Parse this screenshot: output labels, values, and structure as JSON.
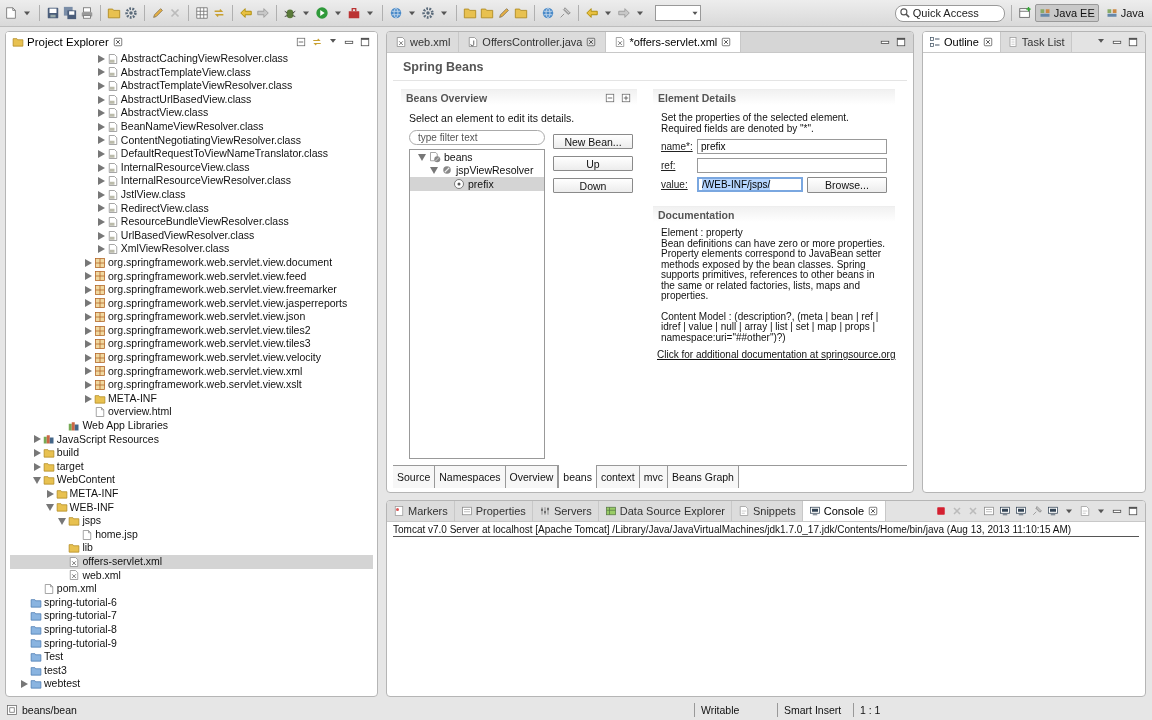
{
  "toolbar": {
    "quick_access": {
      "placeholder": "Quick Access"
    },
    "perspectives": [
      {
        "label": "Java EE",
        "selected": true
      },
      {
        "label": "Java",
        "selected": false
      }
    ]
  },
  "project_explorer": {
    "title": "Project Explorer",
    "tree": [
      {
        "children": [
          {
            "children": [
              {
                "children": [
                  {
                    "children": [
                      {
                        "children": [
                          {
                            "children": [
                              {
                                "label": "AbstractCachingViewResolver.class",
                                "kind": "class",
                                "expanded": false,
                                "selected": false
                              },
                              {
                                "label": "AbstractTemplateView.class",
                                "kind": "class",
                                "expanded": false,
                                "selected": false
                              },
                              {
                                "label": "AbstractTemplateViewResolver.class",
                                "kind": "class",
                                "expanded": false,
                                "selected": false
                              },
                              {
                                "label": "AbstractUrlBasedView.class",
                                "kind": "class",
                                "expanded": false,
                                "selected": false
                              },
                              {
                                "label": "AbstractView.class",
                                "kind": "class",
                                "expanded": false,
                                "selected": false
                              },
                              {
                                "label": "BeanNameViewResolver.class",
                                "kind": "class",
                                "expanded": false,
                                "selected": false
                              },
                              {
                                "label": "ContentNegotiatingViewResolver.class",
                                "kind": "class",
                                "expanded": false,
                                "selected": false
                              },
                              {
                                "label": "DefaultRequestToViewNameTranslator.class",
                                "kind": "class",
                                "expanded": false,
                                "selected": false
                              },
                              {
                                "label": "InternalResourceView.class",
                                "kind": "class",
                                "expanded": false,
                                "selected": false
                              },
                              {
                                "label": "InternalResourceViewResolver.class",
                                "kind": "class",
                                "expanded": false,
                                "selected": false
                              },
                              {
                                "label": "JstlView.class",
                                "kind": "class",
                                "expanded": false,
                                "selected": false
                              },
                              {
                                "label": "RedirectView.class",
                                "kind": "class",
                                "expanded": false,
                                "selected": false
                              },
                              {
                                "label": "ResourceBundleViewResolver.class",
                                "kind": "class",
                                "expanded": false,
                                "selected": false
                              },
                              {
                                "label": "UrlBasedViewResolver.class",
                                "kind": "class",
                                "expanded": false,
                                "selected": false
                              },
                              {
                                "label": "XmlViewResolver.class",
                                "kind": "class",
                                "expanded": false,
                                "selected": false
                              }
                            ]
                          },
                          {
                            "label": "org.springframework.web.servlet.view.document",
                            "kind": "package",
                            "expanded": false,
                            "selected": false
                          },
                          {
                            "label": "org.springframework.web.servlet.view.feed",
                            "kind": "package",
                            "expanded": false,
                            "selected": false
                          },
                          {
                            "label": "org.springframework.web.servlet.view.freemarker",
                            "kind": "package",
                            "expanded": false,
                            "selected": false
                          },
                          {
                            "label": "org.springframework.web.servlet.view.jasperreports",
                            "kind": "package",
                            "expanded": false,
                            "selected": false
                          },
                          {
                            "label": "org.springframework.web.servlet.view.json",
                            "kind": "package",
                            "expanded": false,
                            "selected": false
                          },
                          {
                            "label": "org.springframework.web.servlet.view.tiles2",
                            "kind": "package",
                            "expanded": false,
                            "selected": false
                          },
                          {
                            "label": "org.springframework.web.servlet.view.tiles3",
                            "kind": "package",
                            "expanded": false,
                            "selected": false
                          },
                          {
                            "label": "org.springframework.web.servlet.view.velocity",
                            "kind": "package",
                            "expanded": false,
                            "selected": false
                          },
                          {
                            "label": "org.springframework.web.servlet.view.xml",
                            "kind": "package",
                            "expanded": false,
                            "selected": false
                          },
                          {
                            "label": "org.springframework.web.servlet.view.xslt",
                            "kind": "package",
                            "expanded": false,
                            "selected": false
                          },
                          {
                            "label": "META-INF",
                            "kind": "folder",
                            "expanded": false,
                            "selected": false
                          },
                          {
                            "label": "overview.html",
                            "kind": "file",
                            "selected": false
                          }
                        ]
                      }
                    ]
                  },
                  {
                    "label": "Web App Libraries",
                    "kind": "library",
                    "selected": false
                  }
                ]
              }
            ]
          },
          {
            "label": "JavaScript Resources",
            "kind": "library",
            "expanded": false,
            "selected": false
          },
          {
            "label": "build",
            "kind": "folder",
            "expanded": false,
            "selected": false
          },
          {
            "label": "target",
            "kind": "folder",
            "expanded": false,
            "selected": false
          },
          {
            "label": "WebContent",
            "kind": "folder",
            "expanded": true,
            "selected": false,
            "children": [
              {
                "label": "META-INF",
                "kind": "folder",
                "expanded": false,
                "selected": false
              },
              {
                "label": "WEB-INF",
                "kind": "folder",
                "expanded": true,
                "selected": false,
                "children": [
                  {
                    "label": "jsps",
                    "kind": "folder",
                    "expanded": true,
                    "selected": false,
                    "children": [
                      {
                        "label": "home.jsp",
                        "kind": "file",
                        "selected": false
                      }
                    ]
                  },
                  {
                    "label": "lib",
                    "kind": "folder",
                    "selected": false
                  },
                  {
                    "label": "offers-servlet.xml",
                    "kind": "xml",
                    "selected": true
                  },
                  {
                    "label": "web.xml",
                    "kind": "xml",
                    "selected": false
                  }
                ]
              }
            ]
          },
          {
            "label": "pom.xml",
            "kind": "file",
            "selected": false
          }
        ]
      },
      {
        "label": "spring-tutorial-6",
        "kind": "project",
        "selected": false
      },
      {
        "label": "spring-tutorial-7",
        "kind": "project",
        "selected": false
      },
      {
        "label": "spring-tutorial-8",
        "kind": "project",
        "selected": false
      },
      {
        "label": "spring-tutorial-9",
        "kind": "project",
        "selected": false
      },
      {
        "label": "Test",
        "kind": "project",
        "selected": false
      },
      {
        "label": "test3",
        "kind": "project",
        "selected": false
      },
      {
        "label": "webtest",
        "kind": "project",
        "expanded": false,
        "selected": false
      }
    ]
  },
  "editor": {
    "tabs": [
      {
        "label": "web.xml",
        "kind": "xml",
        "closable": false,
        "selected": false
      },
      {
        "label": "OffersController.java",
        "kind": "java",
        "closable": true,
        "selected": false
      },
      {
        "label": "*offers-servlet.xml",
        "kind": "xml",
        "closable": true,
        "selected": true
      }
    ],
    "page_title": "Spring Beans",
    "beans_overview": {
      "title": "Beans Overview",
      "instructions": "Select an element to edit its details.",
      "filter": {
        "placeholder": "type filter text"
      },
      "tree": [
        {
          "label": "beans",
          "kind": "beans",
          "expanded": true,
          "selected": false,
          "children": [
            {
              "label": "jspViewResolver",
              "kind": "bean",
              "expanded": true,
              "selected": false,
              "children": [
                {
                  "label": "prefix",
                  "kind": "property",
                  "selected": true
                }
              ]
            }
          ]
        }
      ],
      "buttons": [
        "New Bean...",
        "Up",
        "Down"
      ]
    },
    "element_details": {
      "title": "Element Details",
      "description": "Set the properties of the selected element. Required fields are denoted by \"*\".",
      "fields": [
        {
          "label": "name*:",
          "value": "prefix",
          "focused": false
        },
        {
          "label": "ref:",
          "focused": false
        },
        {
          "label": "value:",
          "value": "/WEB-INF/jsps/",
          "focused": true,
          "button": "Browse..."
        }
      ]
    },
    "documentation": {
      "title": "Documentation",
      "blocks": [
        [
          "Element : property",
          "Bean definitions can have zero or more properties. Property elements correspond to JavaBean setter methods exposed by the bean classes. Spring supports primitives, references to other beans in the same or related factories, lists, maps and properties."
        ],
        [
          "Content Model : (description?, (meta | bean | ref | idref | value | null | array | list | set | map | props | namespace:uri=\"##other\")?)"
        ]
      ],
      "link": "Click for additional documentation at springsource.org"
    },
    "page_tabs": [
      {
        "label": "Source",
        "selected": false
      },
      {
        "label": "Namespaces",
        "selected": false
      },
      {
        "label": "Overview",
        "selected": false
      },
      {
        "label": "beans",
        "selected": true
      },
      {
        "label": "context",
        "selected": false
      },
      {
        "label": "mvc",
        "selected": false
      },
      {
        "label": "Beans Graph",
        "selected": false
      }
    ]
  },
  "outline": {
    "tabs": [
      {
        "label": "Outline",
        "kind": "outline",
        "closable": true,
        "selected": true
      },
      {
        "label": "Task List",
        "kind": "tasks",
        "closable": false,
        "selected": false
      }
    ]
  },
  "console": {
    "tabs": [
      {
        "label": "Markers",
        "kind": "markers",
        "closable": false,
        "selected": false
      },
      {
        "label": "Properties",
        "kind": "properties",
        "closable": false,
        "selected": false
      },
      {
        "label": "Servers",
        "kind": "servers",
        "closable": false,
        "selected": false
      },
      {
        "label": "Data Source Explorer",
        "kind": "datasource",
        "closable": false,
        "selected": false
      },
      {
        "label": "Snippets",
        "kind": "snippets",
        "closable": false,
        "selected": false
      },
      {
        "label": "Console",
        "kind": "console",
        "closable": true,
        "selected": true
      }
    ],
    "line": "Tomcat v7.0 Server at localhost [Apache Tomcat] /Library/Java/JavaVirtualMachines/jdk1.7.0_17.jdk/Contents/Home/bin/java (Aug 13, 2013 11:10:15 AM)"
  },
  "status_bar": {
    "path": "beans/bean",
    "items": [
      "Writable",
      "Smart Insert",
      "1 : 1"
    ]
  }
}
